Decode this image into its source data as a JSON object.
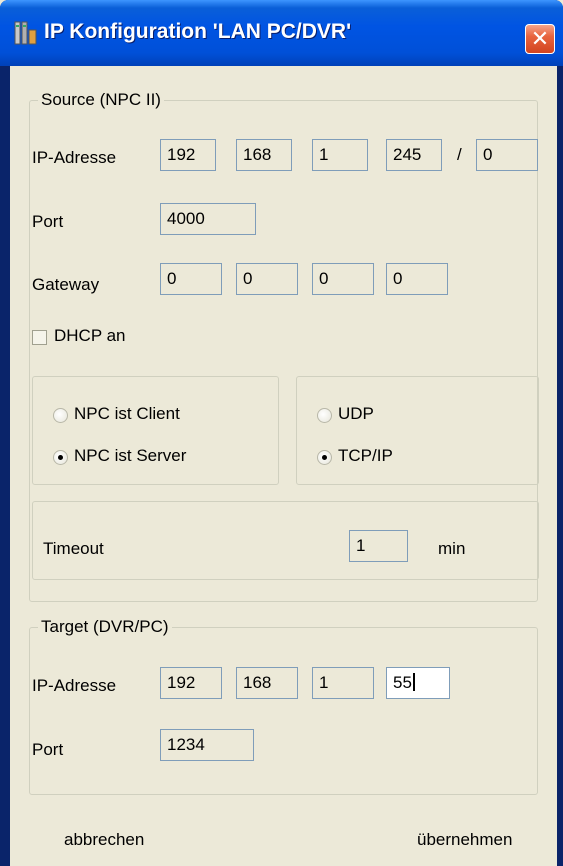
{
  "window": {
    "title": "IP Konfiguration 'LAN PC/DVR'",
    "close_symbol": "✕"
  },
  "source": {
    "legend": "Source (NPC II)",
    "ip_label": "IP-Adresse",
    "ip": [
      "192",
      "168",
      "1",
      "245"
    ],
    "ip_separator": "/",
    "subnet": "0",
    "port_label": "Port",
    "port": "4000",
    "gateway_label": "Gateway",
    "gateway": [
      "0",
      "0",
      "0",
      "0"
    ],
    "dhcp_label": "DHCP an",
    "dhcp_checked": false,
    "mode_options": [
      "NPC ist Client",
      "NPC ist Server"
    ],
    "mode_selected": "NPC ist Server",
    "protocol_options": [
      "UDP",
      "TCP/IP"
    ],
    "protocol_selected": "TCP/IP",
    "timeout_label": "Timeout",
    "timeout": "1",
    "timeout_unit": "min"
  },
  "target": {
    "legend": "Target (DVR/PC)",
    "ip_label": "IP-Adresse",
    "ip": [
      "192",
      "168",
      "1",
      "55"
    ],
    "port_label": "Port",
    "port": "1234"
  },
  "buttons": {
    "cancel": "abbrechen",
    "apply": "übernehmen"
  },
  "colors": {
    "titlebar": "#0054e3",
    "face": "#ece9d8",
    "field_border": "#7f9db9",
    "close_button": "#d2441f"
  }
}
